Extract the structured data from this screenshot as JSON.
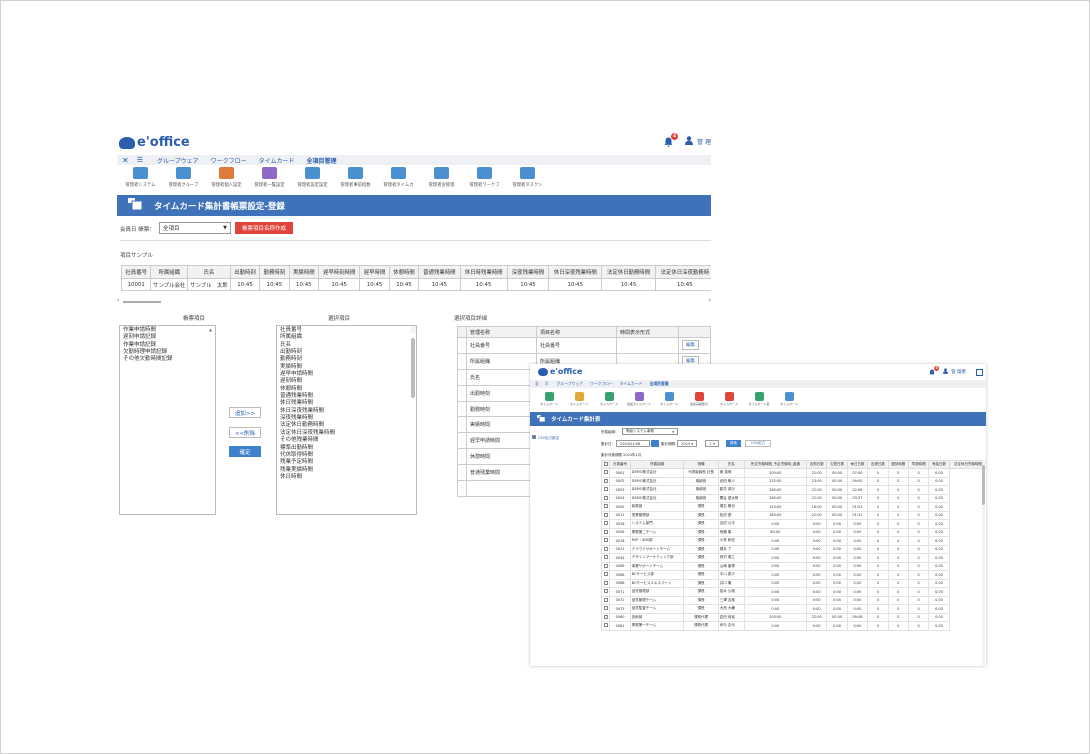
{
  "header": {
    "logo": "e'office",
    "user": "管 理",
    "badge": "4"
  },
  "menu": [
    "グループウェア",
    "ワークフロー",
    "タイムカード",
    "全項目管理"
  ],
  "icons": [
    "管理者システム",
    "管理者グループ",
    "管理者個人設定",
    "管理者一覧設定",
    "管理者設定設定",
    "管理者事前指数",
    "管理者タイムカ",
    "管理者会管理",
    "管理者ワークフ",
    "管理者タスクシ"
  ],
  "page_title": "タイムカード集計書帳票設定-登録",
  "form": {
    "label": "会員日 帳票：",
    "select": "全項目",
    "btn": "帳票項目名称作成"
  },
  "sample": {
    "label": "項目サンプル",
    "headers": [
      "社員番号",
      "所属組織",
      "氏名",
      "出勤時刻",
      "勤務時刻",
      "実績時間",
      "遅早時刻時間",
      "遅早時間",
      "休憩時間",
      "普通残業時間",
      "休日時残業時間",
      "深夜残業時間",
      "休日深夜残業時間",
      "法定休日勤務時間",
      "法定休日深夜勤務時"
    ],
    "row": [
      "10001",
      "サンプル会社",
      "サンプル　太郎",
      "10:45",
      "10:45",
      "10:45",
      "10:45",
      "10:45",
      "10:45",
      "10:45",
      "10:45",
      "10:45",
      "10:45",
      "10:45",
      "10:45"
    ]
  },
  "panels": {
    "left_label": "帳票項目",
    "mid_label": "選択項目",
    "right_label": "選択項目詳細"
  },
  "left_items": [
    "作業申請時間",
    "遅刻申請記録",
    "作業申請記録",
    "欠勤時理申請記録",
    "その他欠勤時間記録"
  ],
  "mid_items": [
    "社員番号",
    "所属組織",
    "氏名",
    "出勤時刻",
    "勤務時刻",
    "実績時間",
    "遅早申請時間",
    "遅刻時間",
    "休憩時間",
    "普通残業時間",
    "休日残業時間",
    "休日深夜残業時間",
    "深夜残業時間",
    "法定休日勤務時間",
    "法定休日深夜残業時間",
    "その他残業時間",
    "標準出勤時間",
    "代休取得時間",
    "残業予定時間",
    "残業実績時間",
    "休日時間"
  ],
  "buttons": {
    "add": "追加>>",
    "remove": "<<削除",
    "confirm": "確定"
  },
  "detail": {
    "headers": [
      "管理名称",
      "項目名称",
      "時間表示形式",
      ""
    ],
    "rows": [
      [
        "社員番号",
        "社員番号",
        "",
        "編集"
      ],
      [
        "所属組織",
        "所属組織",
        "",
        "編集"
      ],
      [
        "氏名",
        "",
        "",
        ""
      ],
      [
        "出勤時刻",
        "",
        "",
        ""
      ],
      [
        "勤務時刻",
        "",
        "",
        ""
      ],
      [
        "実績時間",
        "",
        "",
        ""
      ],
      [
        "遅早申請時間",
        "",
        "",
        ""
      ],
      [
        "休憩時間",
        "",
        "",
        ""
      ],
      [
        "普通残業時間",
        "",
        "",
        ""
      ],
      [
        "",
        "",
        "",
        ""
      ]
    ]
  },
  "w2": {
    "user": "管 理者",
    "menu": [
      "全",
      "ポ",
      "グループウェア",
      "ワークフロー",
      "タイムカード",
      "全項目管理"
    ],
    "icons": [
      "タイムカード",
      "タイムカード",
      "タイムカード",
      "追加タイムカード",
      "タイムカード",
      "追加実績集計",
      "タイムカード",
      "タイムカード集",
      "タイムカード"
    ],
    "title": "タイムカード集計表",
    "filter": {
      "label": "所属組織：",
      "select": "等級システム事務",
      "date_label": "集計日：",
      "date": "2024/01/06",
      "period_label": "集計期間：",
      "year": "2024",
      "month": "1",
      "btn_search": "検索",
      "btn_export": "CSV出力"
    },
    "note": "CSV出力設定",
    "caption": "集計対象期間 2024年1月",
    "headers": [
      "",
      "社員番号",
      "所属組織",
      "役職",
      "氏名",
      "所定労働時間_予定労働時_普通",
      "出勤日数",
      "欠勤日数",
      "休日日数",
      "出張日数",
      "遅刻時間",
      "早退時間",
      "有給日数",
      "法定休日労働時間"
    ],
    "rows": [
      [
        "0001",
        "DEMO株式会社",
        "代表取締役 社長",
        "東 英明",
        "200:00",
        "22:00",
        "00:00",
        "07:00",
        "0",
        "0",
        "0",
        "0.00"
      ],
      [
        "0002",
        "DEMO株式会社",
        "取締役",
        "武田 敬人",
        "232:00",
        "23:00",
        "00:00",
        "09:00",
        "0",
        "0",
        "0",
        "0.00"
      ],
      [
        "0003",
        "DEMO株式会社",
        "取締役",
        "藤井 英行",
        "260:00",
        "22:00",
        "00:00",
        "02:08",
        "0",
        "0",
        "0",
        "0.00"
      ],
      [
        "0004",
        "DEMO株式会社",
        "取締役",
        "関谷 優太郎",
        "260:00",
        "22:00",
        "00:00",
        "03:37",
        "0",
        "0",
        "0",
        "0.00"
      ],
      [
        "0005",
        "総務部",
        "課長",
        "堀石 勝也",
        "120:00",
        "16:00",
        "00:00",
        "01:03",
        "0",
        "0",
        "0",
        "0.00"
      ],
      [
        "0011",
        "営業管理部",
        "課長",
        "松田 優",
        "160:00",
        "22:00",
        "00:00",
        "01:31",
        "0",
        "0",
        "0",
        "0.00"
      ],
      [
        "0016",
        "システム部門",
        "課長",
        "吉田 公平",
        "0:00",
        "0:00",
        "0:00",
        "0:00",
        "0",
        "0",
        "0",
        "0.00"
      ],
      [
        "0026",
        "業務第二チーム",
        "課長",
        "長瀬 篤",
        "80:00",
        "0:00",
        "0:00",
        "0:00",
        "0",
        "0",
        "0",
        "0.00"
      ],
      [
        "0018",
        "RSP・SNS部",
        "課長",
        "小林 和宏",
        "0:00",
        "0:00",
        "0:00",
        "0:00",
        "0",
        "0",
        "0",
        "0.00"
      ],
      [
        "0021",
        "クラウドサポートチーム",
        "課長",
        "梶本 了",
        "0:00",
        "0:00",
        "0:00",
        "0:00",
        "0",
        "0",
        "0",
        "0.00"
      ],
      [
        "0044",
        "デザインマーケティング部",
        "課長",
        "西村 雅之",
        "0:00",
        "0:00",
        "0:00",
        "0:00",
        "0",
        "0",
        "0",
        "0.00"
      ],
      [
        "0069",
        "事業サポートチーム",
        "課長",
        "山崎 康博",
        "0:00",
        "0:00",
        "0:00",
        "0:00",
        "0",
        "0",
        "0",
        "0.00"
      ],
      [
        "0066",
        "BCサービス部",
        "課長",
        "平川 慶介",
        "0:00",
        "0:00",
        "0:00",
        "0:00",
        "0",
        "0",
        "0",
        "0.00"
      ],
      [
        "0068",
        "BCサービスエキスパート",
        "課長",
        "井口 篤",
        "0:00",
        "0:00",
        "0:00",
        "0:00",
        "0",
        "0",
        "0",
        "0.00"
      ],
      [
        "0071",
        "品質管理部",
        "課長",
        "若木 公雄",
        "0:00",
        "0:00",
        "0:00",
        "0:00",
        "0",
        "0",
        "0",
        "0.00"
      ],
      [
        "0072",
        "品質管理チーム",
        "課長",
        "三澤 友哉",
        "0:00",
        "0:00",
        "0:00",
        "0:00",
        "0",
        "0",
        "0",
        "0.00"
      ],
      [
        "0073",
        "品質監査チーム",
        "課長",
        "大西 大輔",
        "0:00",
        "0:00",
        "0:00",
        "0:00",
        "0",
        "0",
        "0",
        "0.00"
      ],
      [
        "0080",
        "技術部",
        "課長代理",
        "岩田 貴裕",
        "200:00",
        "22:00",
        "00:00",
        "09:08",
        "0",
        "0",
        "0",
        "0.00"
      ],
      [
        "0081",
        "業務第一チーム",
        "課長代理",
        "伊与 友代",
        "0:00",
        "0:00",
        "0:00",
        "0:00",
        "0",
        "0",
        "0",
        "0.00"
      ]
    ]
  }
}
